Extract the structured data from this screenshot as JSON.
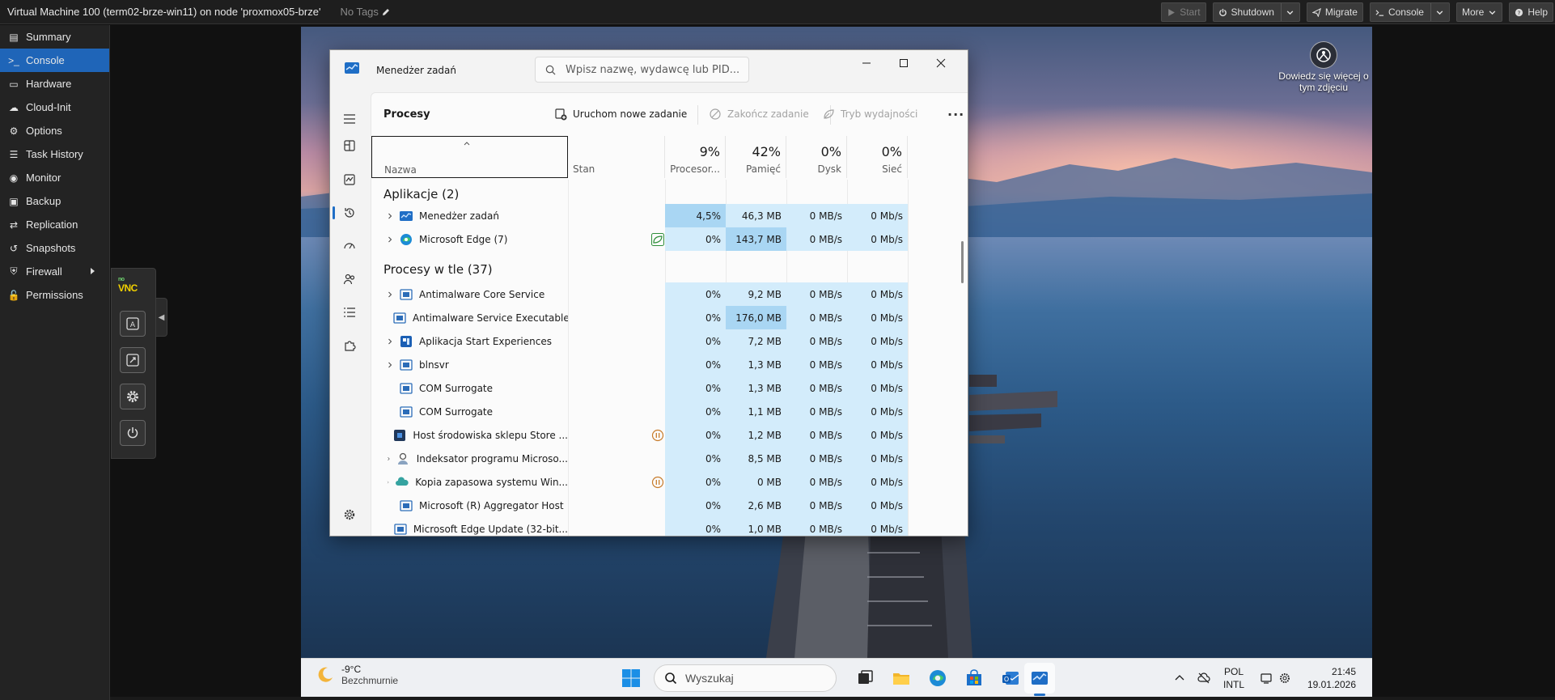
{
  "proxmox": {
    "vm_title": "Virtual Machine 100 (term02-brze-win11) on node 'proxmox05-brze'",
    "tags_label": "No Tags",
    "buttons": {
      "start": "Start",
      "shutdown": "Shutdown",
      "migrate": "Migrate",
      "console": "Console",
      "more": "More",
      "help": "Help"
    },
    "nav": [
      {
        "label": "Summary",
        "icon": "book-icon"
      },
      {
        "label": "Console",
        "icon": "terminal-icon",
        "active": true
      },
      {
        "label": "Hardware",
        "icon": "monitor-icon"
      },
      {
        "label": "Cloud-Init",
        "icon": "cloud-icon"
      },
      {
        "label": "Options",
        "icon": "gear-icon"
      },
      {
        "label": "Task History",
        "icon": "list-icon"
      },
      {
        "label": "Monitor",
        "icon": "eye-icon"
      },
      {
        "label": "Backup",
        "icon": "floppy-icon"
      },
      {
        "label": "Replication",
        "icon": "retweet-icon"
      },
      {
        "label": "Snapshots",
        "icon": "history-icon"
      },
      {
        "label": "Firewall",
        "icon": "shield-icon",
        "has_submenu": true
      },
      {
        "label": "Permissions",
        "icon": "unlock-icon"
      }
    ],
    "novnc_logo": "VNC",
    "novnc_logo_small": "no"
  },
  "wallpaper": {
    "info_text_1": "Dowiedz się więcej o",
    "info_text_2": "tym zdjęciu"
  },
  "taskmgr": {
    "title": "Menedżer zadań",
    "search_placeholder": "Wpisz nazwę, wydawcę lub PID...",
    "page_title": "Procesy",
    "actions": {
      "new_task": "Uruchom nowe zadanie",
      "end_task": "Zakończ zadanie",
      "efficiency": "Tryb wydajności"
    },
    "columns": {
      "name": "Nazwa",
      "status": "Stan",
      "cpu_pct": "9%",
      "cpu": "Procesor...",
      "mem_pct": "42%",
      "mem": "Pamięć",
      "disk_pct": "0%",
      "disk": "Dysk",
      "net_pct": "0%",
      "net": "Sieć"
    },
    "groups": {
      "apps": "Aplikacje (2)",
      "background": "Procesy w tle (37)"
    },
    "apps": [
      {
        "name": "Menedżer zadań",
        "icon": "taskmgr-icon",
        "expandable": true,
        "cpu": "4,5%",
        "mem": "46,3 MB",
        "disk": "0 MB/s",
        "net": "0 Mb/s",
        "status_icon": ""
      },
      {
        "name": "Microsoft Edge (7)",
        "icon": "edge-icon",
        "expandable": true,
        "cpu": "0%",
        "mem": "143,7 MB",
        "disk": "0 MB/s",
        "net": "0 Mb/s",
        "status_icon": "efficiency-leaf-icon"
      }
    ],
    "background": [
      {
        "name": "Antimalware Core Service",
        "icon": "process-icon",
        "expandable": true,
        "cpu": "0%",
        "mem": "9,2 MB",
        "disk": "0 MB/s",
        "net": "0 Mb/s",
        "status_icon": ""
      },
      {
        "name": "Antimalware Service Executable",
        "icon": "process-icon",
        "expandable": true,
        "cpu": "0%",
        "mem": "176,0 MB",
        "disk": "0 MB/s",
        "net": "0 Mb/s",
        "status_icon": ""
      },
      {
        "name": "Aplikacja Start Experiences",
        "icon": "start-exp-icon",
        "expandable": true,
        "cpu": "0%",
        "mem": "7,2 MB",
        "disk": "0 MB/s",
        "net": "0 Mb/s",
        "status_icon": ""
      },
      {
        "name": "blnsvr",
        "icon": "process-icon",
        "expandable": true,
        "cpu": "0%",
        "mem": "1,3 MB",
        "disk": "0 MB/s",
        "net": "0 Mb/s",
        "status_icon": ""
      },
      {
        "name": "COM Surrogate",
        "icon": "process-icon",
        "expandable": false,
        "cpu": "0%",
        "mem": "1,3 MB",
        "disk": "0 MB/s",
        "net": "0 Mb/s",
        "status_icon": ""
      },
      {
        "name": "COM Surrogate",
        "icon": "process-icon",
        "expandable": false,
        "cpu": "0%",
        "mem": "1,1 MB",
        "disk": "0 MB/s",
        "net": "0 Mb/s",
        "status_icon": ""
      },
      {
        "name": "Host środowiska sklepu Store ...",
        "icon": "store-icon",
        "expandable": true,
        "cpu": "0%",
        "mem": "1,2 MB",
        "disk": "0 MB/s",
        "net": "0 Mb/s",
        "status_icon": "paused-icon"
      },
      {
        "name": "Indeksator programu Microso...",
        "icon": "indexer-icon",
        "expandable": true,
        "cpu": "0%",
        "mem": "8,5 MB",
        "disk": "0 MB/s",
        "net": "0 Mb/s",
        "status_icon": ""
      },
      {
        "name": "Kopia zapasowa systemu Win...",
        "icon": "backup-cloud-icon",
        "expandable": true,
        "cpu": "0%",
        "mem": "0 MB",
        "disk": "0 MB/s",
        "net": "0 Mb/s",
        "status_icon": "paused-icon"
      },
      {
        "name": "Microsoft (R) Aggregator Host",
        "icon": "process-icon",
        "expandable": false,
        "cpu": "0%",
        "mem": "2,6 MB",
        "disk": "0 MB/s",
        "net": "0 Mb/s",
        "status_icon": ""
      },
      {
        "name": "Microsoft Edge Update (32-bit...",
        "icon": "process-icon",
        "expandable": false,
        "cpu": "0%",
        "mem": "1,0 MB",
        "disk": "0 MB/s",
        "net": "0 Mb/s",
        "status_icon": ""
      }
    ]
  },
  "taskbar": {
    "weather_temp": "-9°C",
    "weather_desc": "Bezchmurnie",
    "search_label": "Wyszukaj",
    "lang_1": "POL",
    "lang_2": "INTL",
    "time": "21:45",
    "date": "19.01.2026"
  }
}
